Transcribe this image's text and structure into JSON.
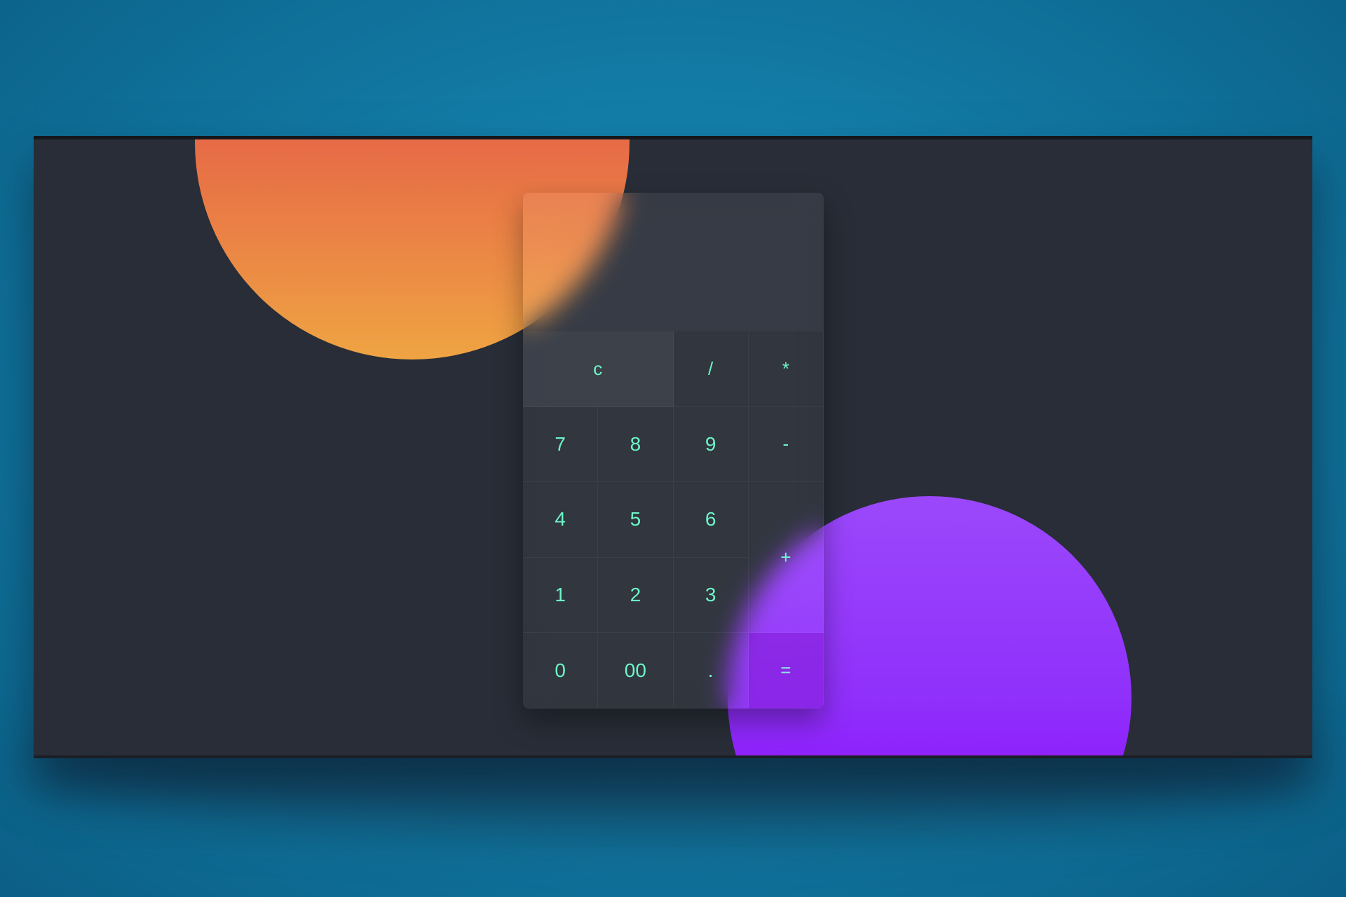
{
  "calculator": {
    "display_value": "",
    "keys": {
      "clear": "c",
      "divide": "/",
      "multiply": "*",
      "seven": "7",
      "eight": "8",
      "nine": "9",
      "minus": "-",
      "four": "4",
      "five": "5",
      "six": "6",
      "plus": "+",
      "one": "1",
      "two": "2",
      "three": "3",
      "zero": "0",
      "double_zero": "00",
      "decimal": ".",
      "equals": "="
    }
  },
  "colors": {
    "page_background": "#137ea8",
    "window_background": "#282d37",
    "key_text": "#6ef5c8",
    "orange_circle_top": "#e0304a",
    "orange_circle_bottom": "#efa443",
    "purple_circle_top": "#9b48fb",
    "purple_circle_bottom": "#8a00ff",
    "equals_key_background": "#841ad7"
  }
}
